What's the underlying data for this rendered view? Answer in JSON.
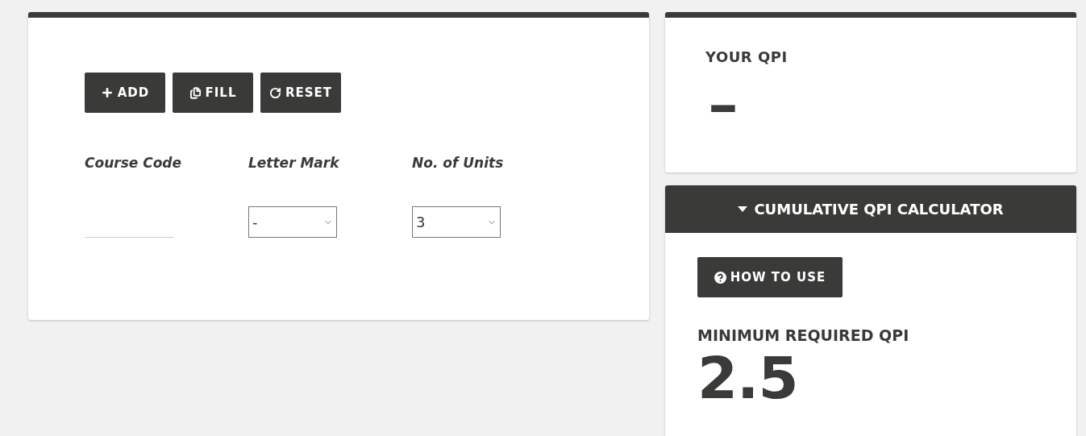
{
  "toolbar": [
    {
      "kind": "add",
      "label": "ADD"
    },
    {
      "kind": "fill",
      "label": "FILL"
    },
    {
      "kind": "reset",
      "label": "RESET"
    }
  ],
  "columns": [
    "Course Code",
    "Letter Mark",
    "No. of Units"
  ],
  "row": {
    "letter_mark": "-",
    "units": "3"
  },
  "qpi": {
    "title": "YOUR QPI",
    "value": "-"
  },
  "calculator": {
    "title": "CUMULATIVE QPI CALCULATOR",
    "expanded": true,
    "help_button": "HOW TO USE",
    "min_label": "MINIMUM REQUIRED QPI",
    "min_value": "2.5"
  }
}
